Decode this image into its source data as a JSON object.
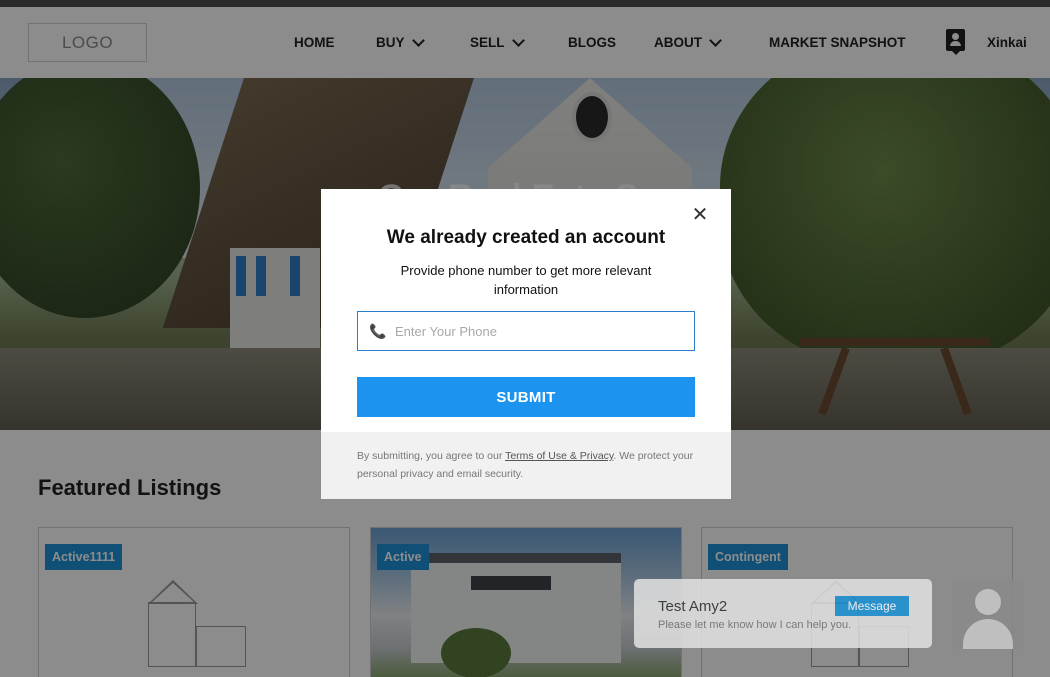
{
  "header": {
    "logo": "LOGO",
    "nav": [
      {
        "label": "HOME",
        "dropdown": false
      },
      {
        "label": "BUY",
        "dropdown": true
      },
      {
        "label": "SELL",
        "dropdown": true
      },
      {
        "label": "BLOGS",
        "dropdown": false
      },
      {
        "label": "ABOUT",
        "dropdown": true
      },
      {
        "label": "MARKET SNAPSHOT",
        "dropdown": false
      }
    ],
    "user_name": "Xinkai",
    "user_icon": "user-contact-icon"
  },
  "hero": {
    "title": "Gre            Real Esta  Ser"
  },
  "featured": {
    "title": "Featured Listings",
    "cards": [
      {
        "badge": "Active1111"
      },
      {
        "badge": "Active"
      },
      {
        "badge": "Contingent"
      }
    ]
  },
  "chat": {
    "name": "Test Amy2",
    "message": "Please let me know how I can help you.",
    "button": "Message"
  },
  "modal": {
    "close_icon": "close-icon",
    "title": "We already created an account",
    "subtitle": "Provide phone number to get more relevant information",
    "phone_placeholder": "Enter Your Phone",
    "phone_icon": "phone-icon",
    "submit_label": "SUBMIT",
    "footer_before": "By submitting, you agree to our ",
    "footer_link": "Terms of Use & Privacy",
    "footer_after": ". We protect your personal privacy and email security."
  },
  "colors": {
    "accent": "#1c93ef",
    "badge": "#1e90d8",
    "overlay": "rgba(0,0,0,0.45)"
  }
}
